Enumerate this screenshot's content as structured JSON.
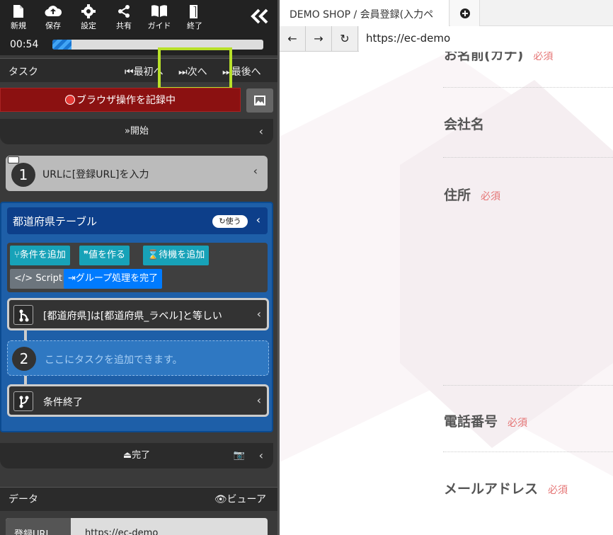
{
  "toolbar": {
    "new_label": "新規",
    "save_label": "保存",
    "settings_label": "設定",
    "share_label": "共有",
    "guide_label": "ガイド",
    "exit_label": "終了"
  },
  "timer": {
    "time": "00:54",
    "progress": 0.09
  },
  "task_header": {
    "title": "タスク",
    "first_label": "最初へ",
    "next_label": "次へ",
    "last_label": "最後へ"
  },
  "record_button": "ブラウザ操作を記録中",
  "start_label": "開始",
  "steps": {
    "step1_num": "1",
    "step1_text": "URLに[登録URL]を入力",
    "group_title": "都道府県テーブル",
    "use_badge": "使う",
    "buttons": {
      "add_condition": "条件を追加",
      "make_value": "値を作る",
      "add_wait": "待機を追加",
      "script": "Script",
      "finish_group": "グループ処理を完了"
    },
    "condition_text": "[都道府県]は[都道府県_ラベル]と等しい",
    "step2_num": "2",
    "add_task_placeholder": "ここにタスクを追加できます。",
    "condition_end_text": "条件終了"
  },
  "finish_label": "完了",
  "data_panel": {
    "title": "データ",
    "viewer_label": "ビューア",
    "row_key": "登録URL",
    "row_value": "https://ec-demo"
  },
  "browser": {
    "tab_title": "DEMO SHOP / 会員登録(入力ペ",
    "new_tab_icon": "plus-circle",
    "url": "https://ec-demo",
    "fields": {
      "kana_label": "お名前(カナ)",
      "kana_required": "必須",
      "company_label": "会社名",
      "address_label": "住所",
      "address_required": "必須",
      "phone_label": "電話番号",
      "phone_required": "必須",
      "email_label": "メールアドレス",
      "email_required": "必須"
    }
  },
  "colors": {
    "highlight": "#b8e02a",
    "record_red": "#8b1111",
    "group_blue": "#1e5fa8",
    "teal": "#17a2b8",
    "required_red": "#e57373"
  }
}
